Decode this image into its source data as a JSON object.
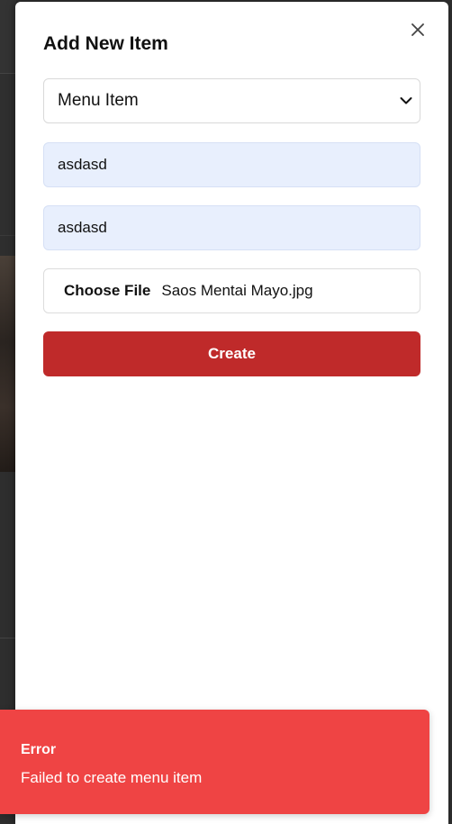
{
  "dialog": {
    "title": "Add New Item",
    "close_icon": "close-icon",
    "type_select": {
      "selected": "Menu Item",
      "icon": "chevron-down-icon"
    },
    "name_value": "asdasd",
    "description_value": "asdasd",
    "file": {
      "button_label": "Choose File",
      "file_name": "Saos Mentai Mayo.jpg"
    },
    "create_label": "Create"
  },
  "toast": {
    "title": "Error",
    "message": "Failed to create menu item",
    "color": "#ef4444"
  },
  "colors": {
    "create_button": "#bf2a2a",
    "autofill_field": "#e8effd"
  }
}
